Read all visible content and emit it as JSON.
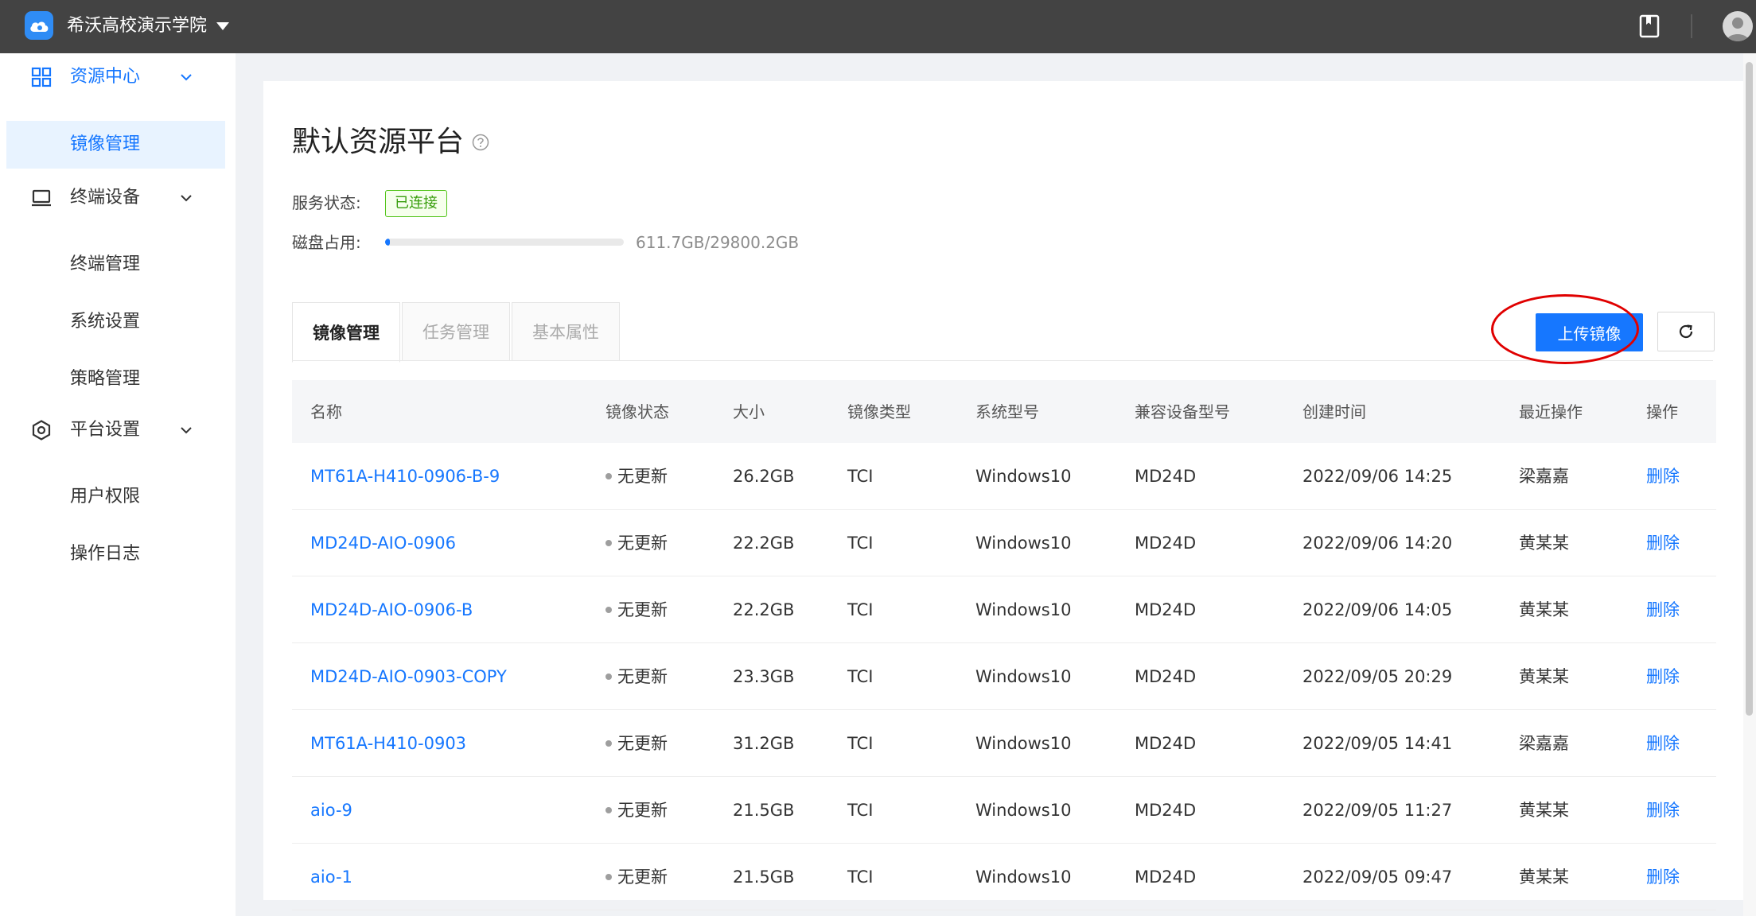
{
  "header": {
    "org_name": "希沃高校演示学院",
    "icons": [
      "logo-icon",
      "book-icon",
      "avatar-icon"
    ]
  },
  "sidebar": {
    "groups": [
      {
        "label": "资源中心",
        "icon": "grid-icon",
        "items": [
          "镜像管理"
        ]
      },
      {
        "label": "终端设备",
        "icon": "monitor-icon",
        "items": [
          "终端管理",
          "系统设置",
          "策略管理"
        ]
      },
      {
        "label": "平台设置",
        "icon": "settings-hex-icon",
        "items": [
          "用户权限",
          "操作日志"
        ]
      }
    ],
    "active_item": "镜像管理"
  },
  "main": {
    "title": "默认资源平台",
    "service_label": "服务状态:",
    "service_status": "已连接",
    "disk_label": "磁盘占用:",
    "disk_usage_text": "611.7GB/29800.2GB",
    "disk_usage_fraction": 0.0205,
    "tabs": [
      {
        "label": "镜像管理",
        "active": true
      },
      {
        "label": "任务管理",
        "active": false
      },
      {
        "label": "基本属性",
        "active": false
      }
    ],
    "upload_label": "上传镜像",
    "colors": {
      "accent": "#1677ff",
      "success": "#52c41a",
      "highlight": "#e00000"
    }
  },
  "table": {
    "columns": [
      "名称",
      "镜像状态",
      "大小",
      "镜像类型",
      "系统型号",
      "兼容设备型号",
      "创建时间",
      "最近操作",
      "操作"
    ],
    "rows": [
      {
        "name": "MT61A-H410-0906-B-9",
        "status": "无更新",
        "size": "26.2GB",
        "type": "TCI",
        "os": "Windows10",
        "device": "MD24D",
        "created": "2022/09/06 14:25",
        "last_op": "梁嘉嘉",
        "action": "删除"
      },
      {
        "name": "MD24D-AIO-0906",
        "status": "无更新",
        "size": "22.2GB",
        "type": "TCI",
        "os": "Windows10",
        "device": "MD24D",
        "created": "2022/09/06 14:20",
        "last_op": "黄某某",
        "action": "删除"
      },
      {
        "name": "MD24D-AIO-0906-B",
        "status": "无更新",
        "size": "22.2GB",
        "type": "TCI",
        "os": "Windows10",
        "device": "MD24D",
        "created": "2022/09/06 14:05",
        "last_op": "黄某某",
        "action": "删除"
      },
      {
        "name": "MD24D-AIO-0903-COPY",
        "status": "无更新",
        "size": "23.3GB",
        "type": "TCI",
        "os": "Windows10",
        "device": "MD24D",
        "created": "2022/09/05 20:29",
        "last_op": "黄某某",
        "action": "删除"
      },
      {
        "name": "MT61A-H410-0903",
        "status": "无更新",
        "size": "31.2GB",
        "type": "TCI",
        "os": "Windows10",
        "device": "MD24D",
        "created": "2022/09/05 14:41",
        "last_op": "梁嘉嘉",
        "action": "删除"
      },
      {
        "name": "aio-9",
        "status": "无更新",
        "size": "21.5GB",
        "type": "TCI",
        "os": "Windows10",
        "device": "MD24D",
        "created": "2022/09/05 11:27",
        "last_op": "黄某某",
        "action": "删除"
      },
      {
        "name": "aio-1",
        "status": "无更新",
        "size": "21.5GB",
        "type": "TCI",
        "os": "Windows10",
        "device": "MD24D",
        "created": "2022/09/05 09:47",
        "last_op": "黄某某",
        "action": "删除"
      }
    ]
  }
}
